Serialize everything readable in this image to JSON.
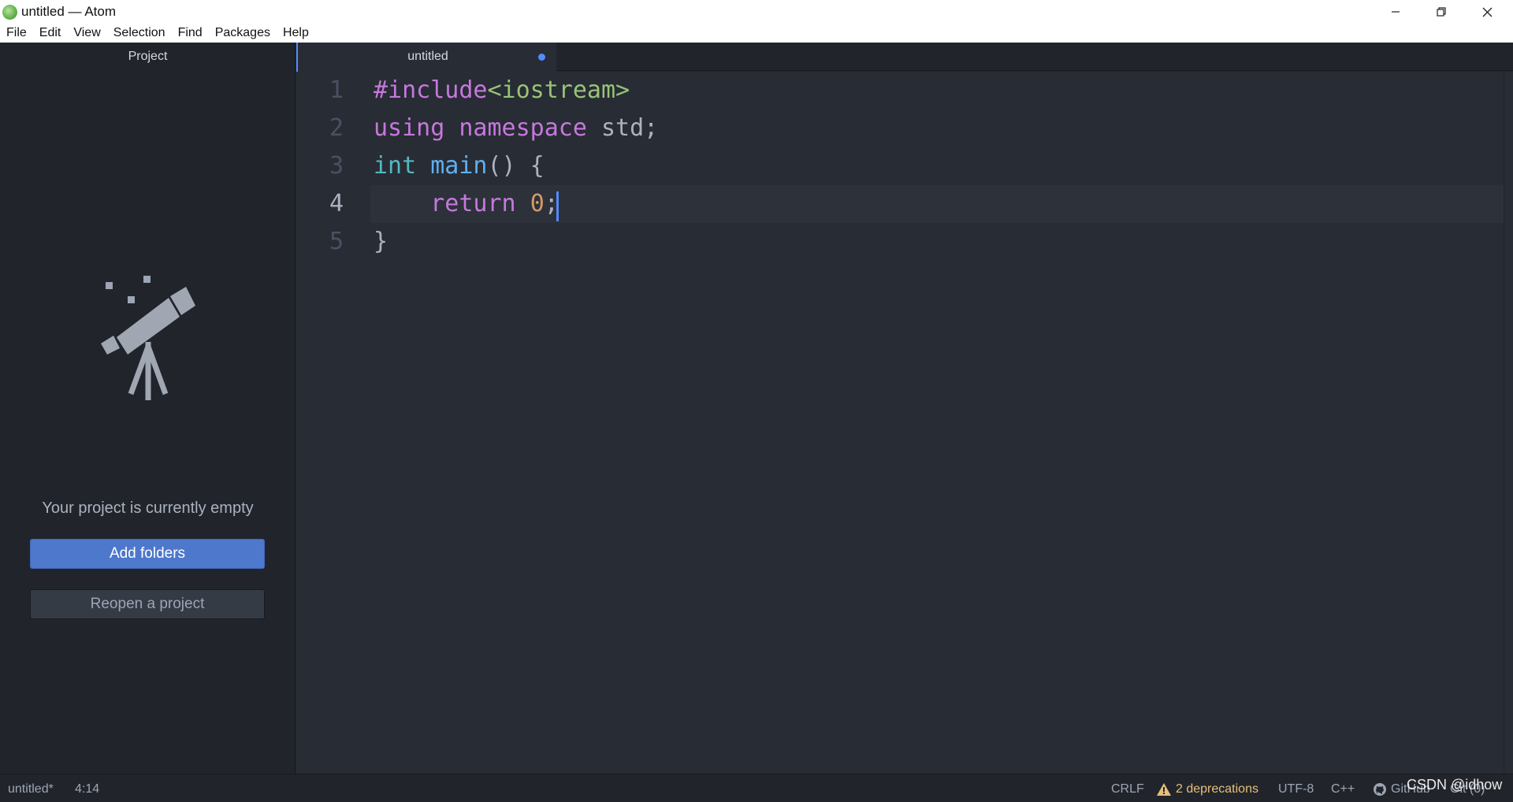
{
  "window": {
    "title": "untitled — Atom",
    "logo_icon": "atom-logo-icon",
    "minimize_icon": "minimize-icon",
    "restore_icon": "restore-icon",
    "close_icon": "close-icon"
  },
  "menu": [
    "File",
    "Edit",
    "View",
    "Selection",
    "Find",
    "Packages",
    "Help"
  ],
  "sidebar": {
    "tab_label": "Project",
    "illustration_icon": "telescope-icon",
    "empty_message": "Your project is currently empty",
    "add_folders_label": "Add folders",
    "reopen_project_label": "Reopen a project"
  },
  "tabs": [
    {
      "title": "untitled",
      "modified": true
    }
  ],
  "editor": {
    "line_numbers": [
      "1",
      "2",
      "3",
      "4",
      "5"
    ],
    "active_line": "4",
    "lines": [
      [
        {
          "t": "#include",
          "c": "kw"
        },
        {
          "t": "<iostream>",
          "c": "inc"
        }
      ],
      [
        {
          "t": "using",
          "c": "kw"
        },
        {
          "t": " ",
          "c": ""
        },
        {
          "t": "namespace",
          "c": "kw"
        },
        {
          "t": " std;",
          "c": ""
        }
      ],
      [
        {
          "t": "int",
          "c": "type"
        },
        {
          "t": " ",
          "c": ""
        },
        {
          "t": "main",
          "c": "fn"
        },
        {
          "t": "() {",
          "c": ""
        }
      ],
      [
        {
          "t": "    ",
          "c": ""
        },
        {
          "t": "return",
          "c": "kw"
        },
        {
          "t": " ",
          "c": ""
        },
        {
          "t": "0",
          "c": "num"
        },
        {
          "t": ";",
          "c": ""
        }
      ],
      [
        {
          "t": "}",
          "c": ""
        }
      ]
    ],
    "colors": {
      "keyword": "#c678dd",
      "include": "#98c379",
      "type": "#56b6c2",
      "function": "#61afef",
      "number": "#d19a66",
      "cursor": "#528bff"
    }
  },
  "status": {
    "file": "untitled*",
    "cursor_position": "4:14",
    "line_ending": "CRLF",
    "deprecations": "2 deprecations",
    "deprecations_icon": "warning-icon",
    "encoding": "UTF-8",
    "grammar": "C++",
    "github_icon": "github-icon",
    "github_label": "GitHub",
    "git_label": "Git (0)",
    "watermark": "CSDN @idhow"
  }
}
